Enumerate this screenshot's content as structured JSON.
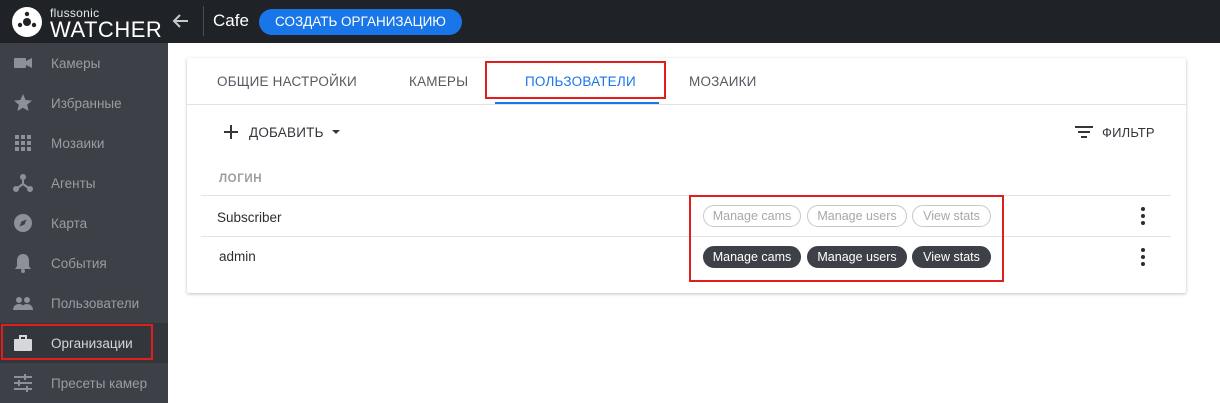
{
  "app": {
    "logo_small": "flussonic",
    "logo_big": "WATCHER"
  },
  "header": {
    "org_name": "Cafe",
    "create_org_label": "СОЗДАТЬ ОРГАНИЗАЦИЮ",
    "accent_color": "#1976e8"
  },
  "sidebar": {
    "items": [
      {
        "label": "Камеры",
        "icon": "camera-icon"
      },
      {
        "label": "Избранные",
        "icon": "star-icon"
      },
      {
        "label": "Мозаики",
        "icon": "grid-icon"
      },
      {
        "label": "Агенты",
        "icon": "agents-icon"
      },
      {
        "label": "Карта",
        "icon": "compass-icon"
      },
      {
        "label": "События",
        "icon": "bell-icon"
      },
      {
        "label": "Пользователи",
        "icon": "users-icon"
      },
      {
        "label": "Организации",
        "icon": "briefcase-icon",
        "active": true
      },
      {
        "label": "Пресеты камер",
        "icon": "sliders-icon"
      }
    ]
  },
  "tabs": [
    {
      "label": "ОБЩИЕ НАСТРОЙКИ"
    },
    {
      "label": "КАМЕРЫ"
    },
    {
      "label": "ПОЛЬЗОВАТЕЛИ",
      "active": true
    },
    {
      "label": "МОЗАИКИ"
    }
  ],
  "toolbar": {
    "add_label": "ДОБАВИТЬ",
    "filter_label": "ФИЛЬТР"
  },
  "table": {
    "column_login": "ЛОГИН",
    "rows": [
      {
        "login": "Subscriber",
        "permissions": [
          {
            "label": "Manage cams",
            "enabled": false
          },
          {
            "label": "Manage users",
            "enabled": false
          },
          {
            "label": "View stats",
            "enabled": false
          }
        ]
      },
      {
        "login": "admin",
        "permissions": [
          {
            "label": "Manage cams",
            "enabled": true
          },
          {
            "label": "Manage users",
            "enabled": true
          },
          {
            "label": "View stats",
            "enabled": true
          }
        ]
      }
    ]
  },
  "highlight_color": "#e01e1e"
}
